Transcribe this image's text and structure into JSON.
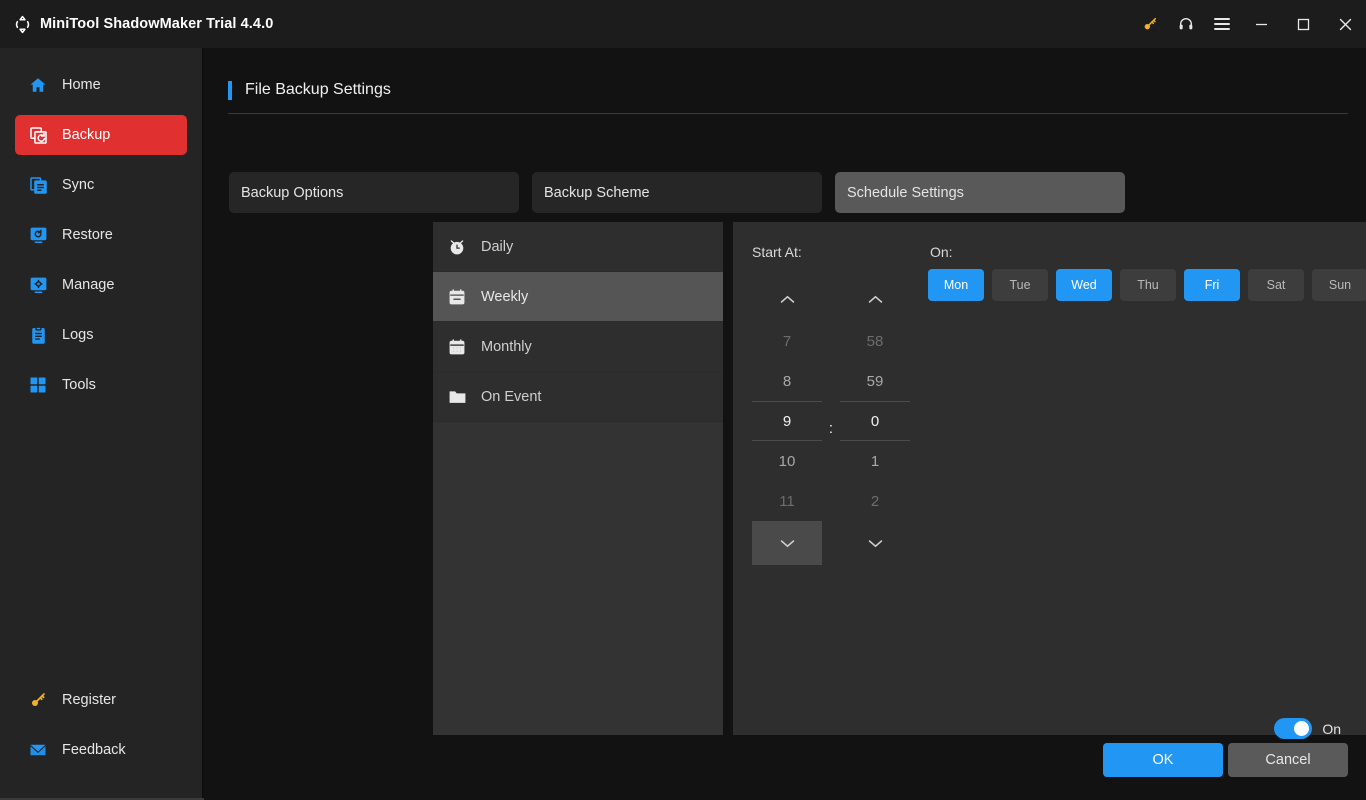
{
  "window": {
    "title": "MiniTool ShadowMaker Trial 4.4.0",
    "logo_icon": "shadowmaker-logo-icon",
    "controls": [
      {
        "name": "key-icon",
        "glyph": "key"
      },
      {
        "name": "headset-icon",
        "glyph": "headset"
      },
      {
        "name": "menu-icon",
        "glyph": "hamburger"
      },
      {
        "name": "minimize-icon",
        "glyph": "minimize"
      },
      {
        "name": "maximize-icon",
        "glyph": "maximize"
      },
      {
        "name": "close-icon",
        "glyph": "close"
      }
    ]
  },
  "sidebar": {
    "items": [
      {
        "label": "Home",
        "icon": "home-icon",
        "active": false
      },
      {
        "label": "Backup",
        "icon": "backup-icon",
        "active": true
      },
      {
        "label": "Sync",
        "icon": "sync-icon",
        "active": false
      },
      {
        "label": "Restore",
        "icon": "restore-icon",
        "active": false
      },
      {
        "label": "Manage",
        "icon": "manage-icon",
        "active": false
      },
      {
        "label": "Logs",
        "icon": "logs-icon",
        "active": false
      },
      {
        "label": "Tools",
        "icon": "tools-icon",
        "active": false
      }
    ],
    "bottom_items": [
      {
        "label": "Register",
        "icon": "key-icon"
      },
      {
        "label": "Feedback",
        "icon": "mail-icon"
      }
    ]
  },
  "page": {
    "title": "File Backup Settings",
    "accent_color": "#2196f3"
  },
  "tabs": [
    {
      "label": "Backup Options",
      "active": false
    },
    {
      "label": "Backup Scheme",
      "active": false
    },
    {
      "label": "Schedule Settings",
      "active": true
    }
  ],
  "schedule_list": [
    {
      "label": "Daily",
      "icon": "alarm-clock-icon",
      "active": false
    },
    {
      "label": "Weekly",
      "icon": "calendar-icon",
      "active": true
    },
    {
      "label": "Monthly",
      "icon": "calendar-grid-icon",
      "active": false
    },
    {
      "label": "On Event",
      "icon": "folder-icon",
      "active": false
    }
  ],
  "detail": {
    "start_at_label": "Start At:",
    "on_label": "On:",
    "hours": [
      {
        "v": "7",
        "state": "dim"
      },
      {
        "v": "8",
        "state": "normal"
      },
      {
        "v": "9",
        "state": "selected"
      },
      {
        "v": "10",
        "state": "normal"
      },
      {
        "v": "11",
        "state": "dim"
      }
    ],
    "minutes": [
      {
        "v": "58",
        "state": "dim"
      },
      {
        "v": "59",
        "state": "normal"
      },
      {
        "v": "0",
        "state": "selected"
      },
      {
        "v": "1",
        "state": "normal"
      },
      {
        "v": "2",
        "state": "dim"
      }
    ],
    "separator": ":",
    "selected_time": "9:0",
    "days": [
      {
        "label": "Mon",
        "selected": true
      },
      {
        "label": "Tue",
        "selected": false
      },
      {
        "label": "Wed",
        "selected": true
      },
      {
        "label": "Thu",
        "selected": false
      },
      {
        "label": "Fri",
        "selected": true
      },
      {
        "label": "Sat",
        "selected": false
      },
      {
        "label": "Sun",
        "selected": false
      }
    ],
    "selected_color": "#2196f3"
  },
  "footer": {
    "toggle_state": "On",
    "toggle_label": "On",
    "ok_label": "OK",
    "cancel_label": "Cancel"
  }
}
